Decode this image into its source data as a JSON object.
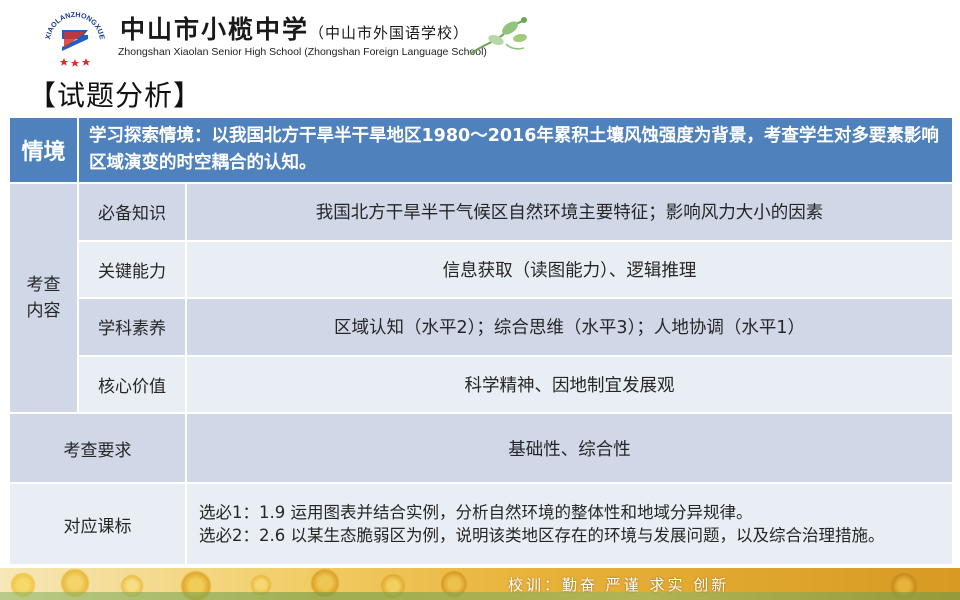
{
  "header": {
    "logo_text": "XIAOLANZHONGXUE",
    "school_name_cn": "中山市小榄中学",
    "school_name_cn_sub": "（中山市外国语学校）",
    "school_name_en": "Zhongshan Xiaolan Senior High School  (Zhongshan Foreign Language School)"
  },
  "section_title": "【试题分析】",
  "table": {
    "context": {
      "label": "情境",
      "text": "学习探索情境：以我国北方干旱半干旱地区1980～2016年累积土壤风蚀强度为背景，考查学生对多要素影响区域演变的时空耦合的认知。"
    },
    "content": {
      "group_label": "考查内容",
      "rows": [
        {
          "label": "必备知识",
          "value": "我国北方干旱半干气候区自然环境主要特征；影响风力大小的因素"
        },
        {
          "label": "关键能力",
          "value": "信息获取（读图能力）、逻辑推理"
        },
        {
          "label": "学科素养",
          "value": "区域认知（水平2）；综合思维（水平3）；人地协调（水平1）"
        },
        {
          "label": "核心价值",
          "value": "科学精神、因地制宜发展观"
        }
      ]
    },
    "requirement": {
      "label": "考查要求",
      "value": "基础性、综合性"
    },
    "curriculum": {
      "label": "对应课标",
      "lines": [
        "选必1：1.9 运用图表并结合实例，分析自然环境的整体性和地域分异规律。",
        "选必2：2.6 以某生态脆弱区为例，说明该类地区存在的环境与发展问题，以及综合治理措施。"
      ]
    }
  },
  "footer": {
    "motto": "校训：勤奋  严谨  求实  创新"
  },
  "colors": {
    "header_blue": "#4f81bd",
    "row_dark": "#d0d8e8",
    "row_light": "#e9edf4",
    "footer_gold": "#e8b33a"
  }
}
